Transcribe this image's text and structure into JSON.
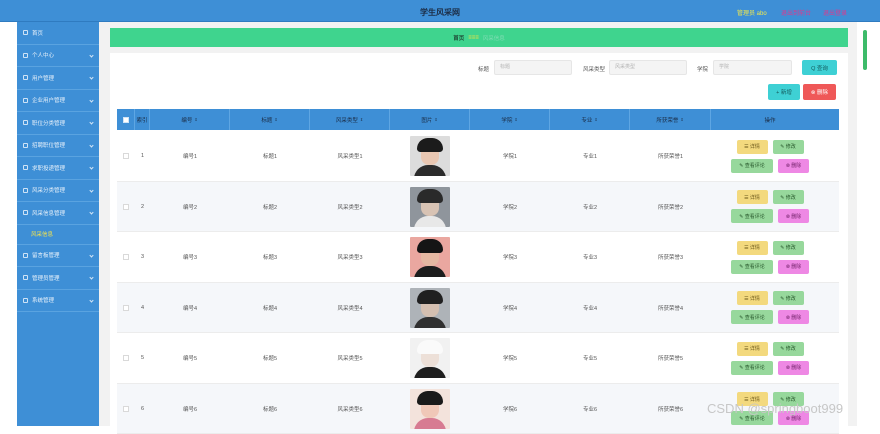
{
  "header": {
    "title": "学生风采网",
    "user": "管理员 abo",
    "link_front": "退出到前台",
    "link_logout": "退出登录"
  },
  "sidebar": {
    "items": [
      {
        "label": "首页",
        "icon": "home-icon"
      },
      {
        "label": "个人中心",
        "icon": "person-icon"
      },
      {
        "label": "用户管理",
        "icon": "users-icon"
      },
      {
        "label": "企业用户管理",
        "icon": "company-icon"
      },
      {
        "label": "职位分类管理",
        "icon": "category-icon"
      },
      {
        "label": "招聘职位管理",
        "icon": "job-icon"
      },
      {
        "label": "求职投递管理",
        "icon": "send-icon"
      },
      {
        "label": "风采分类管理",
        "icon": "tag-icon"
      },
      {
        "label": "风采信息管理",
        "icon": "info-icon"
      }
    ],
    "active_sub": "风采信息",
    "more_items": [
      {
        "label": "留言板管理",
        "icon": "message-icon"
      },
      {
        "label": "管理员管理",
        "icon": "admin-icon"
      },
      {
        "label": "系统管理",
        "icon": "settings-icon"
      }
    ]
  },
  "breadcrumb": {
    "home": "首页",
    "sep": "≡≡≡",
    "current": "风采信息"
  },
  "search": {
    "title_label": "标题",
    "title_placeholder": "标题",
    "type_label": "风采类型",
    "type_placeholder": "风采类型",
    "college_label": "学院",
    "college_placeholder": "学院",
    "search_btn": "Q 查询"
  },
  "actions": {
    "add": "+ 新增",
    "delete": "⊗ 删除"
  },
  "table": {
    "headers": [
      "索引",
      "编号",
      "标题",
      "风采类型",
      "图片",
      "学院",
      "专业",
      "所获荣誉",
      "操作"
    ],
    "rows": [
      {
        "index": "1",
        "code": "编号1",
        "title": "标题1",
        "type": "风采类型1",
        "college": "学院1",
        "major": "专业1",
        "honor": "所获荣誉1",
        "photo": {
          "skin": "#e9c7b2",
          "hair": "#1b1b1b",
          "bg": "#dcdcdc",
          "cloth": "#2b2b2b"
        }
      },
      {
        "index": "2",
        "code": "编号2",
        "title": "标题2",
        "type": "风采类型2",
        "college": "学院2",
        "major": "专业2",
        "honor": "所获荣誉2",
        "photo": {
          "skin": "#d8c3b4",
          "hair": "#2a2a2a",
          "bg": "#8f959c",
          "cloth": "#e8e8e8"
        }
      },
      {
        "index": "3",
        "code": "编号3",
        "title": "标题3",
        "type": "风采类型3",
        "college": "学院3",
        "major": "专业3",
        "honor": "所获荣誉3",
        "photo": {
          "skin": "#e6b8a2",
          "hair": "#151515",
          "bg": "#eaa7a0",
          "cloth": "#1d1d1d"
        }
      },
      {
        "index": "4",
        "code": "编号4",
        "title": "标题4",
        "type": "风采类型4",
        "college": "学院4",
        "major": "专业4",
        "honor": "所获荣誉4",
        "photo": {
          "skin": "#d4bfb0",
          "hair": "#202020",
          "bg": "#aeb3b8",
          "cloth": "#303030"
        }
      },
      {
        "index": "5",
        "code": "编号5",
        "title": "标题5",
        "type": "风采类型5",
        "college": "学院5",
        "major": "专业5",
        "honor": "所获荣誉5",
        "photo": {
          "skin": "#ede0d8",
          "hair": "#fafafa",
          "bg": "#f1f1f1",
          "cloth": "#1e1e1e"
        }
      },
      {
        "index": "6",
        "code": "编号6",
        "title": "标题6",
        "type": "风采类型6",
        "college": "学院6",
        "major": "专业6",
        "honor": "所获荣誉6",
        "photo": {
          "skin": "#f0c8b8",
          "hair": "#1a1a1a",
          "bg": "#f3e3dc",
          "cloth": "#d77b92"
        }
      }
    ],
    "ops": {
      "detail": "☰ 详情",
      "edit": "✎ 修改",
      "review": "✎ 查看评论",
      "del": "⊗ 删除"
    }
  },
  "watermark": "CSDN @springboot999",
  "colors": {
    "topbar": "#3e8fd6",
    "breadcrumb": "#3fd48e",
    "accent_teal": "#3ed0d4",
    "danger": "#ef5858"
  }
}
